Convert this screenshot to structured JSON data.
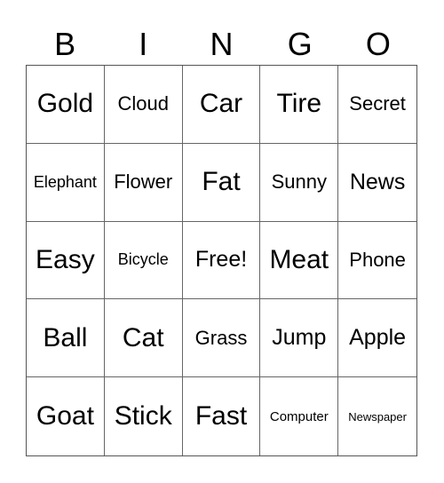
{
  "header": {
    "letters": [
      "B",
      "I",
      "N",
      "G",
      "O"
    ]
  },
  "board": {
    "rows": [
      [
        "Gold",
        "Cloud",
        "Car",
        "Tire",
        "Secret"
      ],
      [
        "Elephant",
        "Flower",
        "Fat",
        "Sunny",
        "News"
      ],
      [
        "Easy",
        "Bicycle",
        "Free!",
        "Meat",
        "Phone"
      ],
      [
        "Ball",
        "Cat",
        "Grass",
        "Jump",
        "Apple"
      ],
      [
        "Goat",
        "Stick",
        "Fast",
        "Computer",
        "Newspaper"
      ]
    ],
    "free_space": "Free!"
  }
}
